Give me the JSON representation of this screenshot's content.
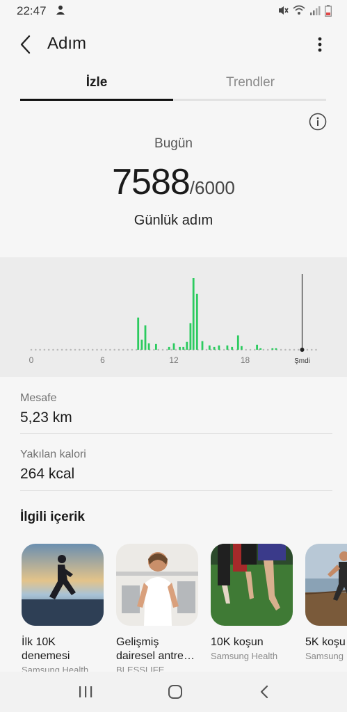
{
  "status_bar": {
    "time": "22:47"
  },
  "header": {
    "title": "Adım"
  },
  "tabs": [
    {
      "label": "İzle",
      "active": true
    },
    {
      "label": "Trendler",
      "active": false
    }
  ],
  "summary": {
    "day_label": "Bugün",
    "steps": "7588",
    "goal": "/6000",
    "caption": "Günlük adım"
  },
  "chart_data": {
    "type": "bar",
    "x_ticks": [
      "0",
      "6",
      "12",
      "18",
      "Şmdi"
    ],
    "bar_color": "#2ccb5f",
    "x_range": [
      0,
      24
    ],
    "y_range": [
      0,
      1000
    ],
    "bars": [
      {
        "x": 9.0,
        "y": 450
      },
      {
        "x": 9.3,
        "y": 140
      },
      {
        "x": 9.6,
        "y": 340
      },
      {
        "x": 9.9,
        "y": 90
      },
      {
        "x": 10.5,
        "y": 80
      },
      {
        "x": 11.6,
        "y": 40
      },
      {
        "x": 12.0,
        "y": 90
      },
      {
        "x": 12.5,
        "y": 40
      },
      {
        "x": 12.8,
        "y": 40
      },
      {
        "x": 13.1,
        "y": 110
      },
      {
        "x": 13.4,
        "y": 370
      },
      {
        "x": 13.65,
        "y": 1000
      },
      {
        "x": 13.95,
        "y": 780
      },
      {
        "x": 14.4,
        "y": 120
      },
      {
        "x": 15.0,
        "y": 60
      },
      {
        "x": 15.4,
        "y": 40
      },
      {
        "x": 15.8,
        "y": 60
      },
      {
        "x": 16.5,
        "y": 60
      },
      {
        "x": 16.9,
        "y": 40
      },
      {
        "x": 17.4,
        "y": 200
      },
      {
        "x": 17.7,
        "y": 50
      },
      {
        "x": 19.0,
        "y": 70
      },
      {
        "x": 19.3,
        "y": 20
      },
      {
        "x": 20.3,
        "y": 20
      },
      {
        "x": 20.6,
        "y": 20
      }
    ],
    "now_x": 22.8
  },
  "stats": [
    {
      "label": "Mesafe",
      "value": "5,23 km"
    },
    {
      "label": "Yakılan kalori",
      "value": "264 kcal"
    }
  ],
  "related": {
    "heading": "İlgili içerik",
    "cards": [
      {
        "title": "İlk 10K denemesi",
        "title1": "İlk 10K",
        "title2": "denemesi",
        "source": "Samsung Health",
        "icon": "runner-sunset-image"
      },
      {
        "title": "Gelişmiş dairesel antre…",
        "title1": "Gelişmiş",
        "title2": "dairesel antre…",
        "source": "BLESSLIFE",
        "icon": "gym-woman-image"
      },
      {
        "title": "10K koşun",
        "title1": "10K koşun",
        "title2": "",
        "source": "Samsung Health",
        "icon": "group-runners-image"
      },
      {
        "title": "5K koşu",
        "title1": "5K koşu",
        "title2": "",
        "source": "Samsung",
        "icon": "boardwalk-runners-image"
      }
    ]
  },
  "colors": {
    "accent_bar": "#2ccb5f",
    "background": "#f6f6f6",
    "chart_bg": "#ececec"
  }
}
